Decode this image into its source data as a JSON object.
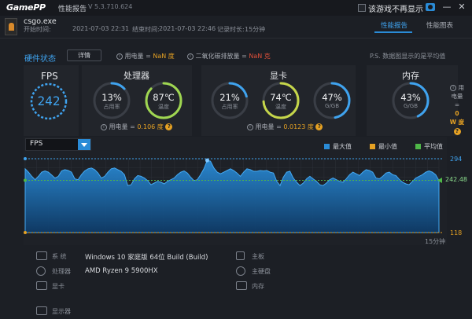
{
  "titlebar": {
    "logo_game": "Game",
    "logo_pp": "PP",
    "title": "性能报告",
    "version": "V 5.3.710.624",
    "checkbox_label": "该游戏不再显示",
    "minimize": "—",
    "close": "✕"
  },
  "game": {
    "name": "csgo.exe",
    "start_label": "开始时间:",
    "start_time": "2021-07-03 22:31",
    "end_label": "结束时间:",
    "end_time": "2021-07-03 22:46",
    "duration_label": "记录时长:",
    "duration": "15分钟"
  },
  "tabs": [
    {
      "label": "性能报告",
      "active": true
    },
    {
      "label": "性能图表",
      "active": false
    }
  ],
  "hardware": {
    "title": "硬件状态",
    "detail_button": "详情",
    "power_label": "用电量 =",
    "power_value": "NaN 度",
    "co2_label": "二氧化碳排放量 =",
    "co2_value": "NaN 克",
    "note": "P.S. 数据图显示的是平均值"
  },
  "fps": {
    "label": "FPS",
    "value": "242"
  },
  "cpu": {
    "title": "处理器",
    "usage": "13%",
    "usage_label": "占用率",
    "temp": "87℃",
    "temp_label": "温度",
    "power_label": "用电量 =",
    "power_value": "0.106 度",
    "usage_fraction": 0.13,
    "temp_fraction": 0.87
  },
  "gpu": {
    "title": "显卡",
    "usage": "21%",
    "usage_label": "占用率",
    "temp": "74℃",
    "temp_label": "温度",
    "mem": "47%",
    "mem_label": "G/GB",
    "power_label": "用电量 =",
    "power_value": "0.0123 度",
    "usage_fraction": 0.21,
    "temp_fraction": 0.74,
    "mem_fraction": 0.47
  },
  "memory": {
    "title": "内存",
    "usage": "43%",
    "usage_label": "G/GB",
    "usage_fraction": 0.43,
    "side_label_1": "用",
    "side_label_2": "电量",
    "side_eq": "=",
    "side_value": "0",
    "side_unit": "W 度"
  },
  "chart": {
    "dropdown": "FPS",
    "legend": [
      {
        "label": "最大值",
        "color": "#2a8bd6"
      },
      {
        "label": "最小值",
        "color": "#e5a123"
      },
      {
        "label": "平均值",
        "color": "#4fb848"
      }
    ],
    "duration_label": "15分钟"
  },
  "chart_data": {
    "type": "area",
    "y_max_label": "294",
    "y_avg_label": "242.48",
    "y_min_label": "118",
    "ylim": [
      118,
      294
    ],
    "max": 294,
    "avg": 242.48,
    "min": 118,
    "values": [
      270,
      262,
      252,
      244,
      252,
      262,
      265,
      262,
      255,
      248,
      252,
      265,
      268,
      266,
      262,
      246,
      244,
      256,
      265,
      270,
      272,
      268,
      260,
      248,
      252,
      262,
      270,
      272,
      268,
      264,
      256,
      230,
      232,
      246,
      254,
      252,
      248,
      242,
      232,
      236,
      240,
      238,
      234,
      240,
      244,
      248,
      256,
      262,
      265,
      260,
      250,
      242,
      244,
      256,
      270,
      290,
      288,
      272,
      262,
      258,
      262,
      266,
      270,
      266,
      260,
      252,
      262,
      270,
      268,
      264,
      264,
      266,
      265,
      266,
      262,
      260,
      240,
      230,
      250,
      262,
      264,
      248,
      238,
      230,
      236,
      246,
      252,
      246,
      240,
      232,
      230,
      236,
      244,
      248,
      244,
      240,
      238,
      246,
      256,
      262,
      258,
      254,
      262,
      268,
      266,
      262,
      248,
      246,
      252,
      260,
      262,
      256,
      254,
      245,
      238,
      234,
      232,
      240,
      248,
      252,
      256,
      262,
      265,
      262,
      256,
      242
    ]
  },
  "system": {
    "os_label": "系  统",
    "os_value": "Windows 10 家庭版 64位   Build (Build)",
    "cpu_label": "处理器",
    "cpu_value": "AMD Ryzen 9 5900HX",
    "gpu_label": "显卡",
    "display_label": "显示器",
    "board_label": "主板",
    "disk_label": "主硬盘",
    "mem_label": "内存"
  },
  "colors": {
    "accent": "#2a8bd6",
    "ring_blue": "#3fa3ef",
    "ring_temp_cpu": "#9fd651",
    "ring_temp_gpu": "#c5d64a",
    "ring_track": "#3a3e46",
    "warning": "#e5a123"
  }
}
